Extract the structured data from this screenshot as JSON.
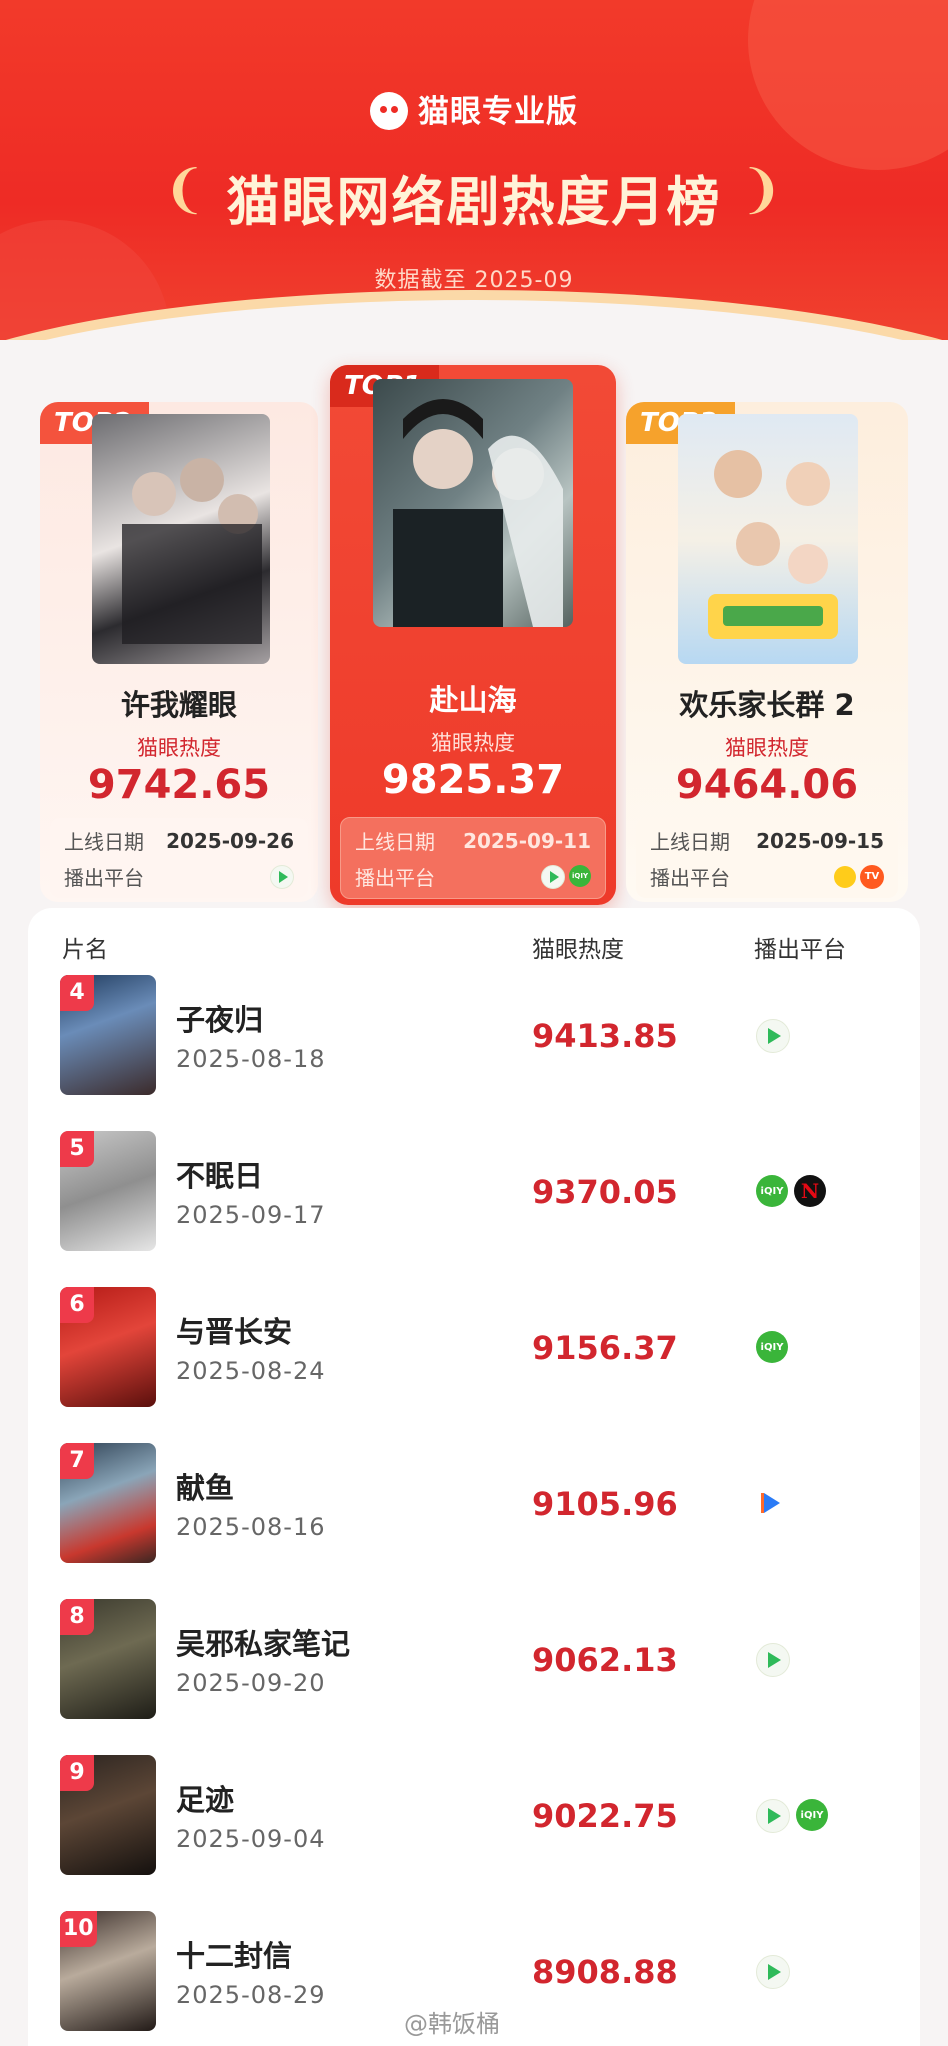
{
  "header": {
    "brand": "猫眼专业版",
    "title": "猫眼网络剧热度月榜",
    "data_as_of": "数据截至 2025-09"
  },
  "labels": {
    "heat": "猫眼热度",
    "release_date": "上线日期",
    "platform": "播出平台"
  },
  "top3": [
    {
      "tag": "TOP2",
      "name": "许我耀眼",
      "score": "9742.65",
      "date": "2025-09-26",
      "platforms": [
        "tencent"
      ]
    },
    {
      "tag": "TOP1",
      "name": "赴山海",
      "score": "9825.37",
      "date": "2025-09-11",
      "platforms": [
        "tencent",
        "iqiyi"
      ]
    },
    {
      "tag": "TOP3",
      "name": "欢乐家长群 2",
      "score": "9464.06",
      "date": "2025-09-15",
      "platforms": [
        "mango",
        "mgtv"
      ]
    }
  ],
  "list_header": {
    "name": "片名",
    "heat": "猫眼热度",
    "platform": "播出平台"
  },
  "list": [
    {
      "rank": "4",
      "name": "子夜归",
      "date": "2025-08-18",
      "score": "9413.85",
      "platforms": [
        "tencent"
      ]
    },
    {
      "rank": "5",
      "name": "不眠日",
      "date": "2025-09-17",
      "score": "9370.05",
      "platforms": [
        "iqiyi",
        "netflix"
      ]
    },
    {
      "rank": "6",
      "name": "与晋长安",
      "date": "2025-08-24",
      "score": "9156.37",
      "platforms": [
        "iqiyi"
      ]
    },
    {
      "rank": "7",
      "name": "献鱼",
      "date": "2025-08-16",
      "score": "9105.96",
      "platforms": [
        "youku"
      ]
    },
    {
      "rank": "8",
      "name": "吴邪私家笔记",
      "date": "2025-09-20",
      "score": "9062.13",
      "platforms": [
        "tencent"
      ]
    },
    {
      "rank": "9",
      "name": "足迹",
      "date": "2025-09-04",
      "score": "9022.75",
      "platforms": [
        "tencent",
        "iqiyi"
      ]
    },
    {
      "rank": "10",
      "name": "十二封信",
      "date": "2025-08-29",
      "score": "8908.88",
      "platforms": [
        "tencent"
      ]
    }
  ],
  "platform_icon_text": {
    "iqiyi": "iQIY",
    "netflix": "N",
    "mgtv": "TV"
  },
  "watermark": "@韩饭桶",
  "colors": {
    "primary_red": "#ee2b25",
    "score_red": "#d2262e",
    "gold": "#fbd9a8",
    "rank_badge": "#ee3a4a"
  }
}
